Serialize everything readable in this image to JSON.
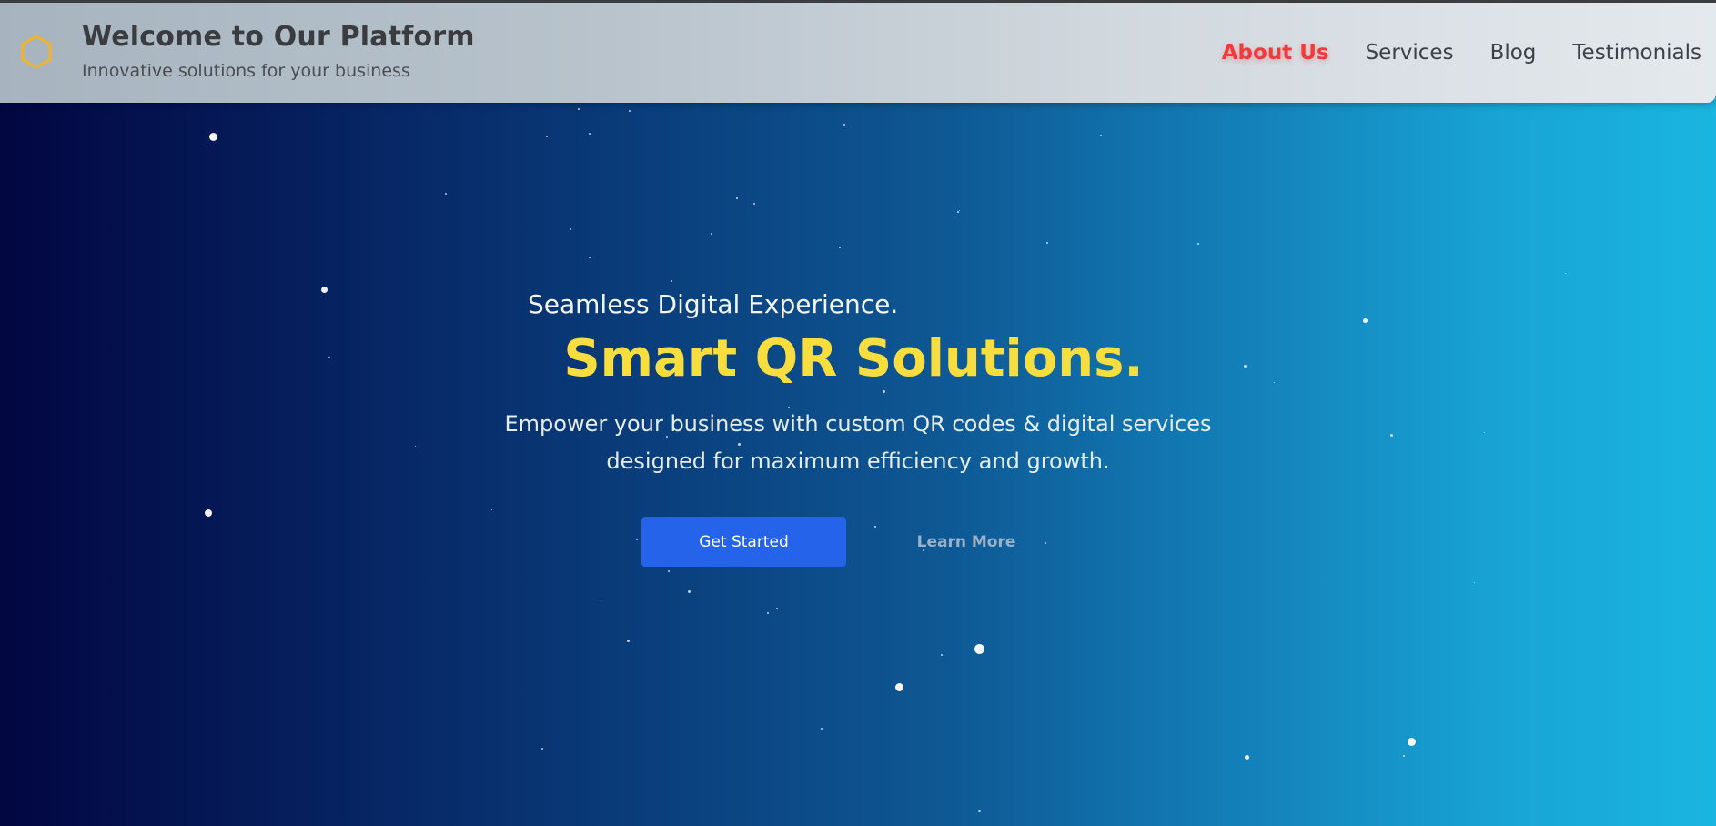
{
  "header": {
    "logo_icon": "hexagon-icon",
    "title": "Welcome to Our Platform",
    "subtitle": "Innovative solutions for your business"
  },
  "nav": {
    "items": [
      {
        "label": "About Us",
        "active": true
      },
      {
        "label": "Services",
        "active": false
      },
      {
        "label": "Blog",
        "active": false
      },
      {
        "label": "Testimonials",
        "active": false
      }
    ]
  },
  "hero": {
    "eyebrow": "Seamless Digital Experience.",
    "headline": "Smart QR Solutions.",
    "description": "Empower your business with custom QR codes & digital services designed for maximum efficiency and growth.",
    "primary_button": "Get Started",
    "secondary_button": "Learn More"
  },
  "colors": {
    "accent_yellow": "#f7de3e",
    "active_nav": "#ef3b3b",
    "primary_button": "#2563eb",
    "logo": "#f0b429"
  }
}
